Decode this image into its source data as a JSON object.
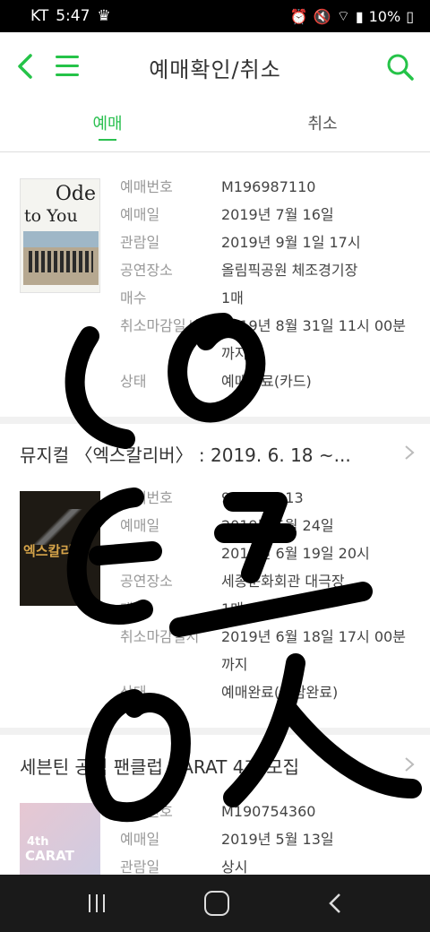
{
  "status_bar": {
    "carrier": "KT",
    "time": "5:47",
    "battery": "10%"
  },
  "app_bar": {
    "title": "예매확인/취소"
  },
  "tabs": [
    {
      "label": "예매",
      "active": true
    },
    {
      "label": "취소",
      "active": false
    }
  ],
  "bookings": [
    {
      "section_title": "",
      "poster_text": {
        "line1": "Ode",
        "line2": "to You"
      },
      "fields": [
        {
          "key": "예매번호",
          "value": "M196987110"
        },
        {
          "key": "예매일",
          "value": "2019년 7월 16일"
        },
        {
          "key": "관람일",
          "value": "2019년 9월 1일 17시"
        },
        {
          "key": "공연장소",
          "value": "올림픽공원 체조경기장"
        },
        {
          "key": "매수",
          "value": "1매"
        },
        {
          "key": "취소마감일시",
          "value": "2019년 8월 31일 11시 00분 까지"
        },
        {
          "key": "상태",
          "value": "예매완료(카드)"
        }
      ]
    },
    {
      "section_title": "뮤지컬 〈엑스칼리버〉 : 2019. 6. 18 ~...",
      "poster_text": {
        "line1": "엑스칼리버"
      },
      "fields": [
        {
          "key": "예매번호",
          "value": "913461913"
        },
        {
          "key": "예매일",
          "value": "2019년 5월 24일"
        },
        {
          "key": "관람일",
          "value": "2019년 6월 19일 20시"
        },
        {
          "key": "공연장소",
          "value": "세종문화회관 대극장"
        },
        {
          "key": "매수",
          "value": "1매"
        },
        {
          "key": "취소마감일시",
          "value": "2019년 6월 18일 17시 00분 까지"
        },
        {
          "key": "상태",
          "value": "예매완료(관람완료)"
        }
      ]
    },
    {
      "section_title": "세븐틴 공식 팬클럽 CARAT 4기 모집",
      "poster_text": {
        "line1": "4th",
        "line2": "CARAT"
      },
      "fields": [
        {
          "key": "예매번호",
          "value": "M190754360"
        },
        {
          "key": "예매일",
          "value": "2019년 5월 13일"
        },
        {
          "key": "관람일",
          "value": "상시"
        }
      ]
    }
  ],
  "colors": {
    "accent": "#2bc050",
    "label": "#999999",
    "value": "#444444"
  }
}
